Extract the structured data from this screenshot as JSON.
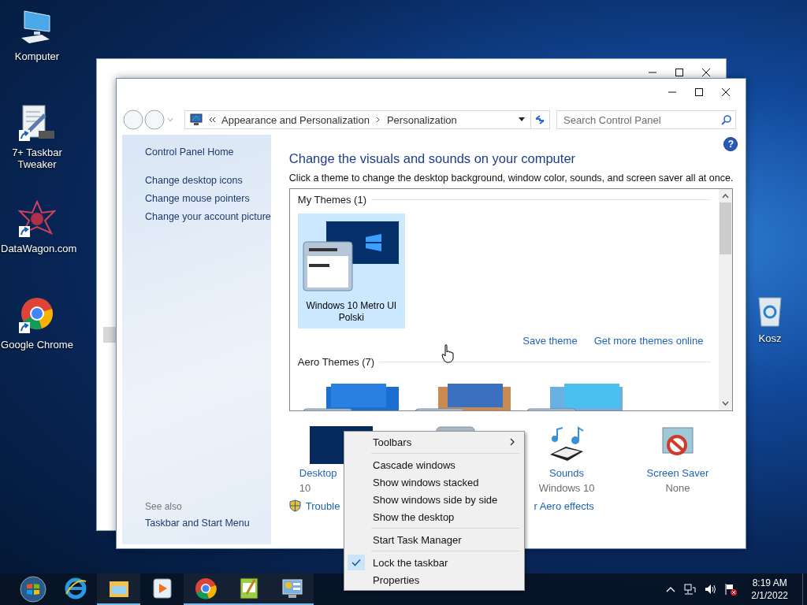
{
  "desktop_icons": [
    {
      "kind": "computer",
      "label": "Komputer",
      "shortcut": false
    },
    {
      "kind": "tweaker",
      "label": "7+ Taskbar Tweaker",
      "shortcut": true
    },
    {
      "kind": "star",
      "label": "DataWagon.com",
      "shortcut": true
    },
    {
      "kind": "chrome",
      "label": "Google Chrome",
      "shortcut": true
    }
  ],
  "recycle_bin": {
    "label": "Kosz"
  },
  "window": {
    "address": {
      "segments": [
        "Appearance and Personalization",
        "Personalization"
      ]
    },
    "search": {
      "placeholder": "Search Control Panel"
    },
    "help": "?",
    "sidebar": {
      "links": [
        "Control Panel Home",
        "Change desktop icons",
        "Change mouse pointers",
        "Change your account picture"
      ],
      "see_also": {
        "heading": "See also",
        "links": [
          "Taskbar and Start Menu"
        ]
      }
    },
    "heading": "Change the visuals and sounds on your computer",
    "description": "Click a theme to change the desktop background, window color, sounds, and screen saver all at once.",
    "theme_groups": [
      {
        "title": "My Themes (1)",
        "themes": [
          {
            "name": "Windows 10 Metro UI Polski",
            "selected": true
          }
        ],
        "links": [
          "Save theme",
          "Get more themes online"
        ]
      },
      {
        "title": "Aero Themes (7)",
        "themes": [
          {
            "selected": false
          },
          {
            "selected": false
          },
          {
            "selected": false
          }
        ]
      }
    ],
    "settings": [
      {
        "kind": "background",
        "label": "Desktop",
        "value": "10"
      },
      {
        "kind": "color"
      },
      {
        "kind": "sounds",
        "label": "Sounds",
        "value": "Windows 10"
      },
      {
        "kind": "screensaver",
        "label": "Screen Saver",
        "value": "None"
      }
    ],
    "footer_links": [
      {
        "kind": "shield",
        "label": "Trouble"
      },
      {
        "kind": "plain",
        "label": "r Aero effects"
      }
    ]
  },
  "context_menu": {
    "items": [
      {
        "kind": "item",
        "label": "Toolbars",
        "submenu": true,
        "checked": false
      },
      {
        "kind": "separator"
      },
      {
        "kind": "item",
        "label": "Cascade windows",
        "submenu": false,
        "checked": false
      },
      {
        "kind": "item",
        "label": "Show windows stacked",
        "submenu": false,
        "checked": false
      },
      {
        "kind": "item",
        "label": "Show windows side by side",
        "submenu": false,
        "checked": false
      },
      {
        "kind": "item",
        "label": "Show the desktop",
        "submenu": false,
        "checked": false
      },
      {
        "kind": "separator"
      },
      {
        "kind": "item",
        "label": "Start Task Manager",
        "submenu": false,
        "checked": false
      },
      {
        "kind": "separator"
      },
      {
        "kind": "item",
        "label": "Lock the taskbar",
        "submenu": false,
        "checked": true
      },
      {
        "kind": "item",
        "label": "Properties",
        "submenu": false,
        "checked": false
      }
    ]
  },
  "taskbar": {
    "apps": [
      {
        "kind": "ie",
        "running": false
      },
      {
        "kind": "explorer",
        "running": true
      },
      {
        "kind": "media",
        "running": false
      },
      {
        "kind": "chrome",
        "running": true
      },
      {
        "kind": "notepad",
        "running": true
      },
      {
        "kind": "control",
        "running": true
      }
    ],
    "clock": {
      "time": "8:19 AM",
      "date": "2/1/2022"
    }
  }
}
